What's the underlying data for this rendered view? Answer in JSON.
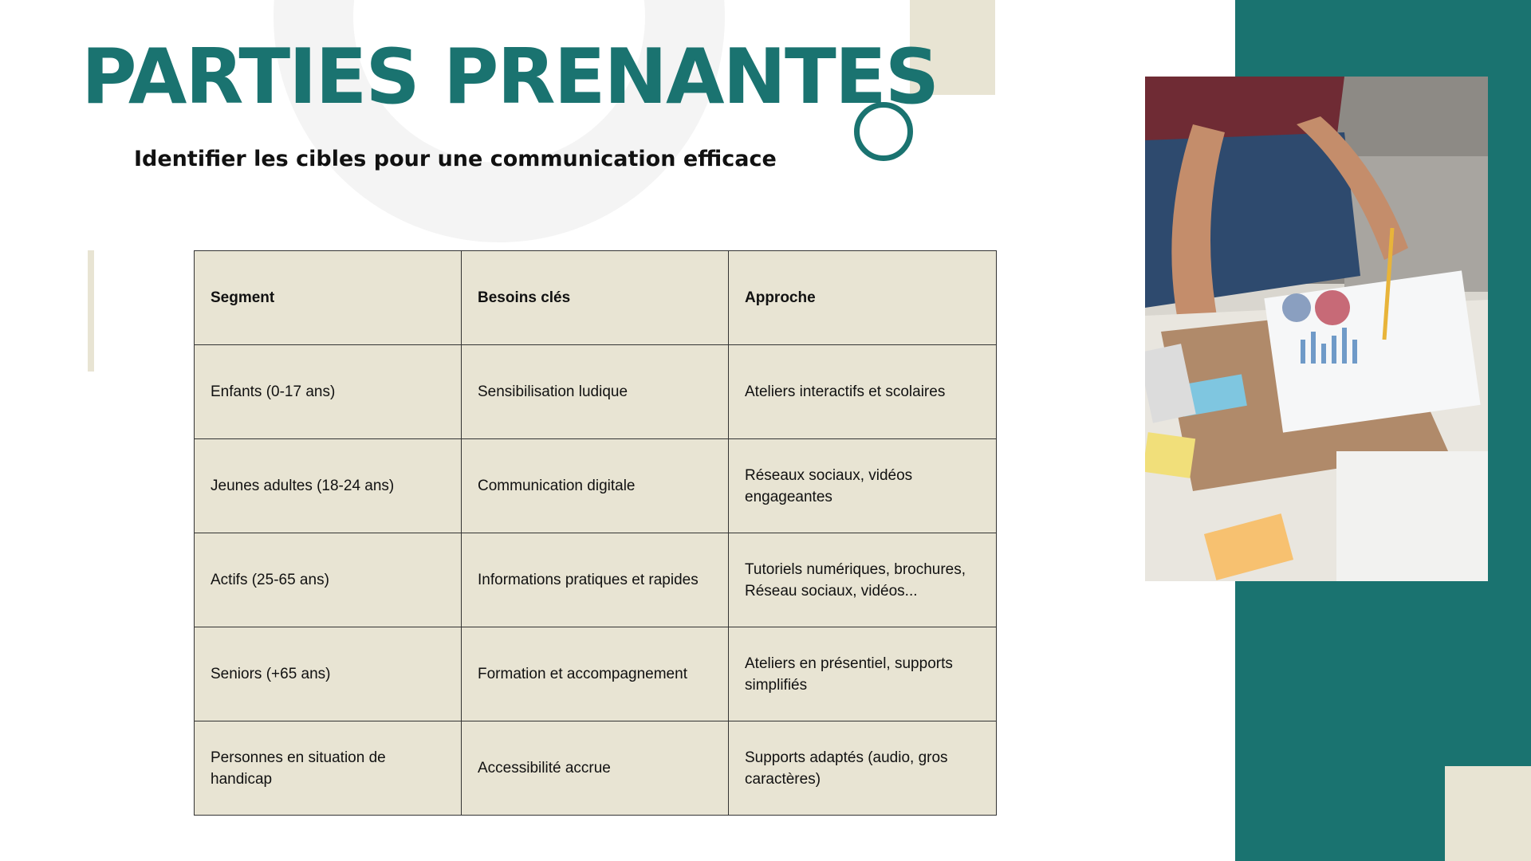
{
  "title": "PARTIES PRENANTES",
  "subtitle": "Identifier les cibles pour une communication efficace",
  "table": {
    "headers": [
      "Segment",
      "Besoins clés",
      "Approche"
    ],
    "rows": [
      [
        "Enfants (0-17 ans)",
        "Sensibilisation ludique",
        "Ateliers interactifs et scolaires"
      ],
      [
        "Jeunes adultes (18-24 ans)",
        "Communication digitale",
        "Réseaux sociaux, vidéos engageantes"
      ],
      [
        "Actifs (25-65 ans)",
        "Informations pratiques et rapides",
        "Tutoriels numériques, brochures, Réseau sociaux, vidéos..."
      ],
      [
        "Seniors (+65 ans)",
        "Formation et accompagnement",
        "Ateliers en présentiel, supports simplifiés"
      ],
      [
        "Personnes en situation de handicap",
        "Accessibilité accrue",
        "Supports adaptés (audio, gros caractères)"
      ]
    ]
  },
  "colors": {
    "teal": "#1a7370",
    "beige": "#e8e4d3"
  }
}
